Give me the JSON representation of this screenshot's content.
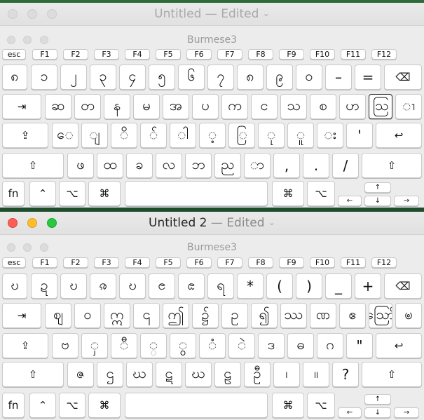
{
  "windows": [
    {
      "title": "Untitled",
      "edited": "Edited",
      "chevron": "⌄",
      "active": false,
      "palette_title": "Burmese3",
      "function_row": [
        "esc",
        "F1",
        "F2",
        "F3",
        "F4",
        "F5",
        "F6",
        "F7",
        "F8",
        "F9",
        "F10",
        "F11",
        "F12"
      ],
      "row1": [
        "၈",
        "၁",
        "၂",
        "၃",
        "၄",
        "၅",
        "၆",
        "၇",
        "၈",
        "၉",
        "၀",
        "–",
        "=",
        "⌫"
      ],
      "row2": [
        "⇥",
        "ဆ",
        "တ",
        "န",
        "မ",
        "အ",
        "ပ",
        "က",
        "င",
        "သ",
        "စ",
        "ဟ",
        "ဩ",
        "ၢ"
      ],
      "row3": [
        "⇪",
        "ေ",
        "ျ",
        "ိ",
        "် ",
        "ါ",
        "့",
        "ြ",
        "ု",
        "ူ",
        "း",
        "'",
        "↩"
      ],
      "row4": [
        "⇧",
        "ဖ",
        "ထ",
        "ခ",
        "လ",
        "ဘ",
        "ည",
        "ာ",
        ",",
        ".",
        "/",
        "⇧"
      ],
      "row5": [
        "fn",
        "⌃",
        "⌥",
        "⌘",
        "",
        "⌘",
        "⌥"
      ],
      "arrows": {
        "up": "↑",
        "left": "←",
        "down": "↓",
        "right": "→"
      }
    },
    {
      "title": "Untitled 2",
      "edited": "Edited",
      "chevron": "⌄",
      "active": true,
      "palette_title": "Burmese3",
      "function_row": [
        "esc",
        "F1",
        "F2",
        "F3",
        "F4",
        "F5",
        "F6",
        "F7",
        "F8",
        "F9",
        "F10",
        "F11",
        "F12"
      ],
      "row1": [
        "ဎ",
        "ဍ",
        "ဎ",
        "ၷ",
        "ဎ",
        "ၔ",
        "ၕ",
        "ရ",
        "*",
        "(",
        ")",
        "_",
        "+",
        "⌫"
      ],
      "row2": [
        "⇥",
        "ဈ",
        "ဝ",
        "ဣ",
        "၎",
        "ဤ",
        "၌",
        "ဥ",
        "၍",
        "ဿ",
        "ဏ",
        "ဧ",
        "ဪ",
        "ၑ"
      ],
      "row3": [
        "⇪",
        "ဗ",
        "ှ",
        "ီ",
        "္",
        "ွ",
        "ံ",
        "ဲ",
        "ဒ",
        "ဓ",
        "ဂ",
        "\"",
        "↩"
      ],
      "row4": [
        "⇧",
        "ဇ",
        "ဌ",
        "ဃ",
        "ဋ",
        "ဃ",
        "ဠ",
        "ဦ",
        "၊",
        "။",
        "?",
        "⇧"
      ],
      "row5": [
        "fn",
        "⌃",
        "⌥",
        "⌘",
        "",
        "⌘",
        "⌥"
      ],
      "arrows": {
        "up": "↑",
        "left": "←",
        "down": "↓",
        "right": "→"
      }
    }
  ]
}
